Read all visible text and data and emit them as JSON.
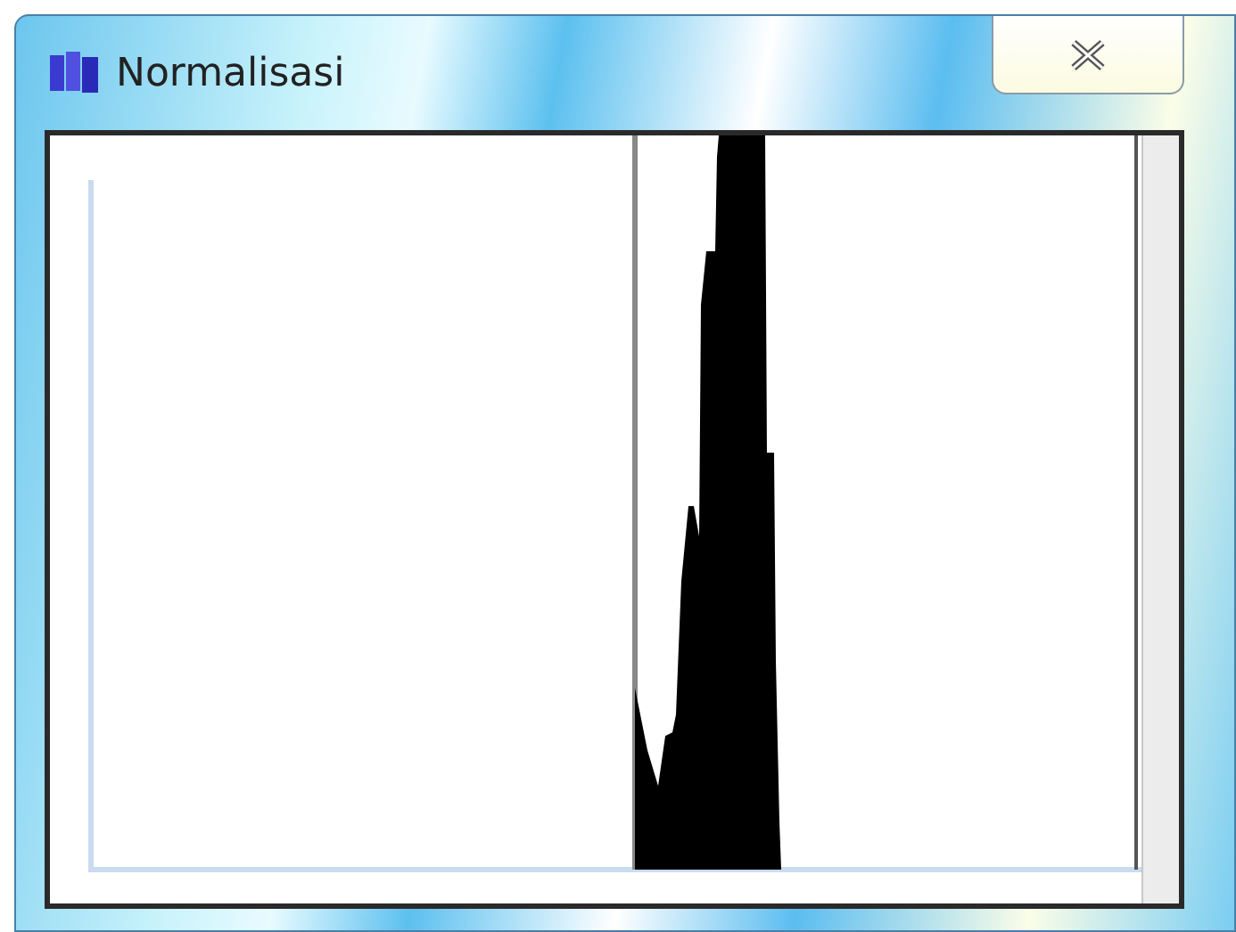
{
  "window": {
    "title": "Normalisasi"
  }
}
